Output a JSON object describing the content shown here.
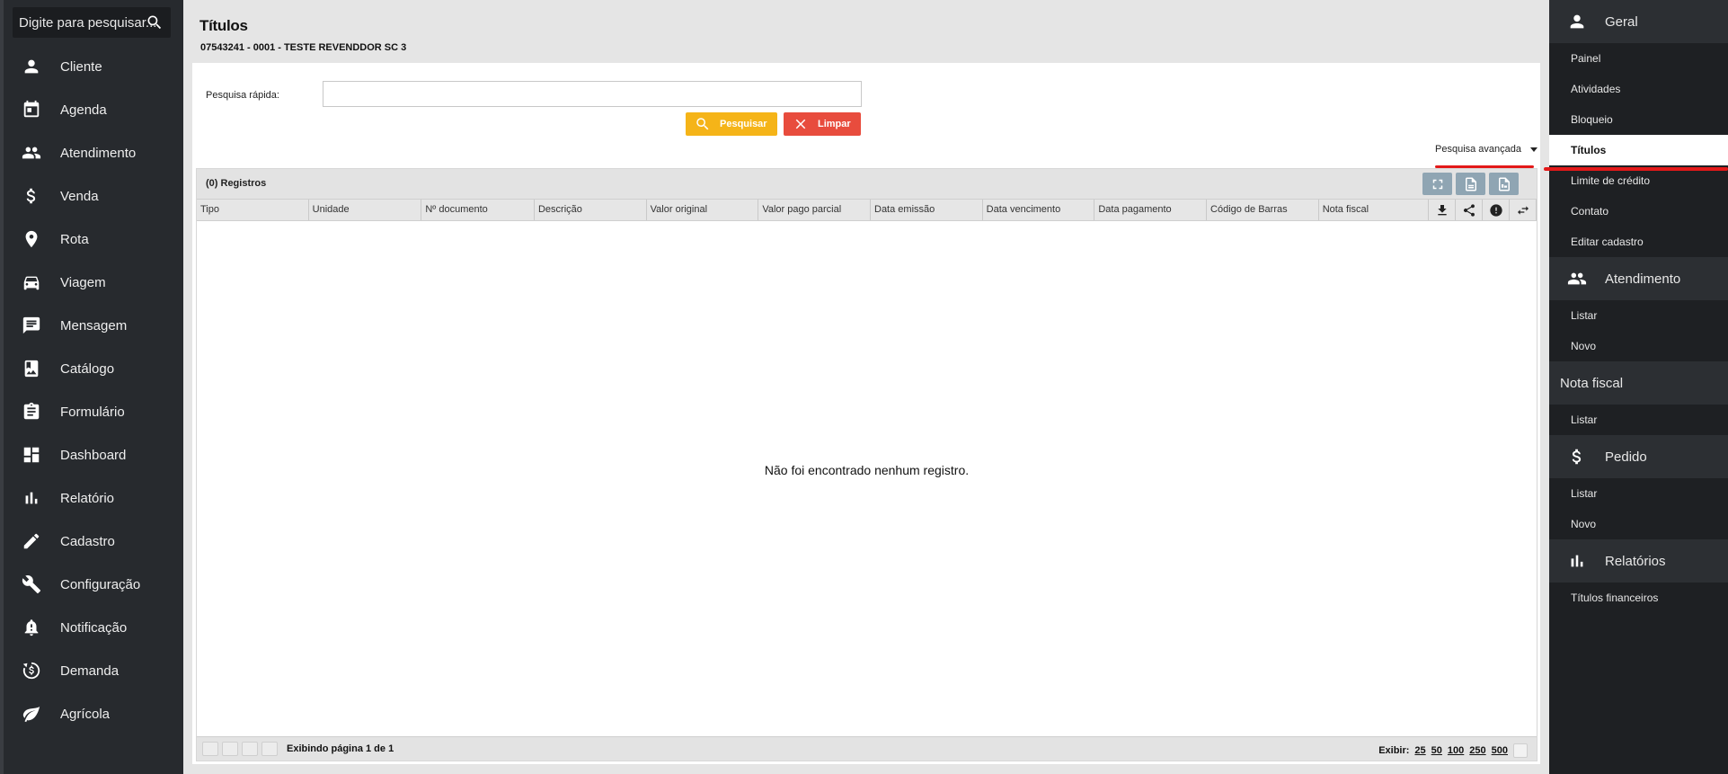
{
  "left_sidebar": {
    "search_placeholder": "Digite para pesquisar...",
    "items": [
      {
        "label": "Cliente",
        "icon": "person-icon"
      },
      {
        "label": "Agenda",
        "icon": "calendar-icon"
      },
      {
        "label": "Atendimento",
        "icon": "people-icon"
      },
      {
        "label": "Venda",
        "icon": "dollar-icon"
      },
      {
        "label": "Rota",
        "icon": "location-pin-icon"
      },
      {
        "label": "Viagem",
        "icon": "car-icon"
      },
      {
        "label": "Mensagem",
        "icon": "message-icon"
      },
      {
        "label": "Catálogo",
        "icon": "catalog-icon"
      },
      {
        "label": "Formulário",
        "icon": "clipboard-icon"
      },
      {
        "label": "Dashboard",
        "icon": "dashboard-icon"
      },
      {
        "label": "Relatório",
        "icon": "bar-chart-icon"
      },
      {
        "label": "Cadastro",
        "icon": "pencil-icon"
      },
      {
        "label": "Configuração",
        "icon": "wrench-icon"
      },
      {
        "label": "Notificação",
        "icon": "bell-icon"
      },
      {
        "label": "Demanda",
        "icon": "money-cycle-icon"
      },
      {
        "label": "Agrícola",
        "icon": "leaf-icon"
      }
    ]
  },
  "header": {
    "title": "Títulos",
    "subtitle": "07543241 - 0001 - TESTE REVENDDOR SC 3"
  },
  "quick_search": {
    "label": "Pesquisa rápida:",
    "value": "",
    "search_button": "Pesquisar",
    "clear_button": "Limpar",
    "advanced_label": "Pesquisa avançada"
  },
  "grid": {
    "records_label": "(0) Registros",
    "columns": [
      "Tipo",
      "Unidade",
      "Nº documento",
      "Descrição",
      "Valor original",
      "Valor pago parcial",
      "Data emissão",
      "Data vencimento",
      "Data pagamento",
      "Código de Barras",
      "Nota fiscal"
    ],
    "empty_message": "Não foi encontrado nenhum registro.",
    "pager_text": "Exibindo página 1 de 1",
    "per_page_label": "Exibir:",
    "per_page_options": [
      "25",
      "50",
      "100",
      "250",
      "500"
    ]
  },
  "right_sidebar": {
    "sections": [
      {
        "title": "Geral",
        "icon": "person-icon",
        "items": [
          "Painel",
          "Atividades",
          "Bloqueio",
          "Títulos",
          "Limite de crédito",
          "Contato",
          "Editar cadastro"
        ]
      },
      {
        "title": "Atendimento",
        "icon": "people-icon",
        "items": [
          "Listar",
          "Novo"
        ]
      },
      {
        "title": "Nota fiscal",
        "icon": "",
        "items": [
          "Listar"
        ]
      },
      {
        "title": "Pedido",
        "icon": "dollar-icon",
        "items": [
          "Listar",
          "Novo"
        ]
      },
      {
        "title": "Relatórios",
        "icon": "bar-chart-icon",
        "items": [
          "Títulos financeiros"
        ]
      }
    ],
    "active_item": "Títulos"
  },
  "colors": {
    "search_button": "#f5b418",
    "clear_button": "#e84c3d",
    "highlight_line": "#e31919",
    "sidebar_bg": "#272a2e"
  }
}
